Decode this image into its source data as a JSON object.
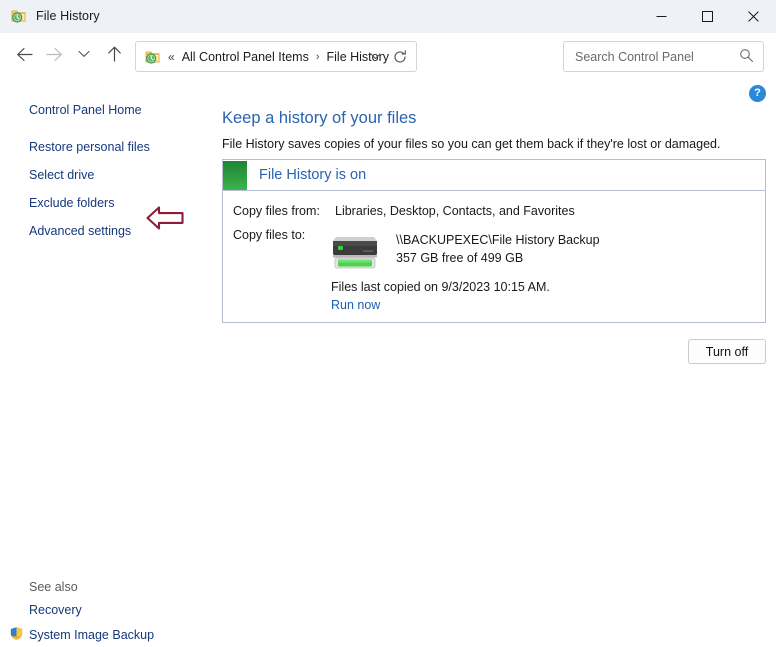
{
  "window": {
    "title": "File History",
    "icon": "file-history-icon",
    "controls": {
      "minimize": "minimize-icon",
      "maximize": "maximize-icon",
      "close": "close-icon"
    }
  },
  "toolbar": {
    "back": "back-arrow-icon",
    "forward": "forward-arrow-icon",
    "recent": "chevron-down-icon",
    "up": "up-arrow-icon",
    "address": {
      "icon": "file-history-icon",
      "overflow": "«",
      "crumbs": [
        "All Control Panel Items",
        "File History"
      ],
      "separator": "›",
      "dropdown": "chevron-down-icon",
      "refresh": "refresh-icon"
    },
    "search": {
      "placeholder": "Search Control Panel",
      "value": "",
      "icon": "search-icon"
    }
  },
  "help": {
    "label": "?",
    "icon": "help-icon"
  },
  "sidebar": {
    "home": "Control Panel Home",
    "items": [
      {
        "label": "Restore personal files"
      },
      {
        "label": "Select drive"
      },
      {
        "label": "Exclude folders"
      },
      {
        "label": "Advanced settings"
      }
    ],
    "see_also_title": "See also",
    "see_also": [
      {
        "label": "Recovery",
        "icon": null
      },
      {
        "label": "System Image Backup",
        "icon": "shield-icon"
      }
    ]
  },
  "annotation": {
    "arrow": "left-arrow-annotation",
    "color": "#8c1c3a",
    "points_at": "Restore personal files"
  },
  "main": {
    "title": "Keep a history of your files",
    "subtitle": "File History saves copies of your files so you can get them back if they're lost or damaged.",
    "panel": {
      "status_title": "File History is on",
      "status_color": "#2c9a3e",
      "rows": [
        {
          "label": "Copy files from:",
          "value": "Libraries, Desktop, Contacts, and Favorites"
        },
        {
          "label": "Copy files to:",
          "value": ""
        }
      ],
      "drive": {
        "icon": "network-drive-icon",
        "name": "\\\\BACKUPEXEC\\File History Backup",
        "free": "357 GB free of 499 GB"
      },
      "last_copied": "Files last copied on 9/3/2023 10:15 AM.",
      "run_now": "Run now"
    },
    "turn_off_label": "Turn off"
  },
  "colors": {
    "titlebar_bg": "#eef1f6",
    "link": "#16387c",
    "heading": "#2a63b0",
    "panel_border": "#b5bed2",
    "status_green": "#2c9a3e",
    "accent_blue": "#2b88d8"
  }
}
